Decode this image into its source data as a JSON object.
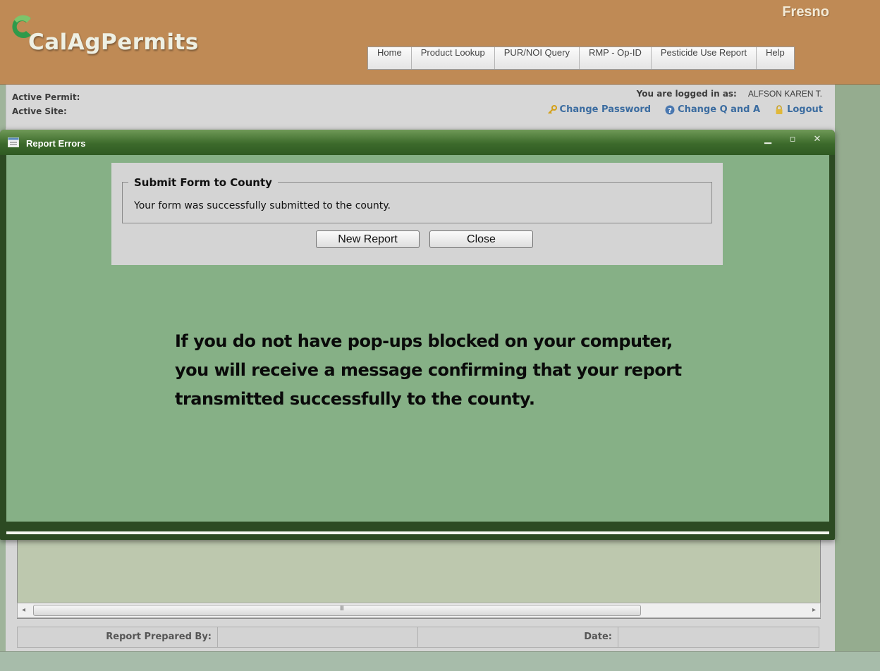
{
  "header": {
    "logo_text": "CalAgPermits",
    "county": "Fresno",
    "nav": [
      {
        "label": "Home"
      },
      {
        "label": "Product Lookup"
      },
      {
        "label": "PUR/NOI Query"
      },
      {
        "label": "RMP - Op-ID"
      },
      {
        "label": "Pesticide Use Report"
      },
      {
        "label": "Help"
      }
    ]
  },
  "info_bar": {
    "active_permit_label": "Active Permit:",
    "active_site_label": "Active Site:",
    "logged_in_label": "You are logged in as:",
    "user_name": "ALFSON KAREN T.",
    "change_password": "Change Password",
    "change_qa": "Change Q and A",
    "logout": "Logout"
  },
  "modal": {
    "title": "Report Errors",
    "fieldset_legend": "Submit Form to County",
    "message": "Your form was successfully submitted to the county.",
    "new_report_button": "New Report",
    "close_button": "Close"
  },
  "annotation": {
    "lines": [
      "If you do not have pop-ups blocked on your computer,",
      "you will receive a message confirming that your report",
      "transmitted successfully to the county."
    ]
  },
  "footer": {
    "prepared_by_label": "Report Prepared By:",
    "date_label": "Date:"
  },
  "scrollbar": {
    "grip": "III"
  },
  "colors": {
    "header_bg": "#bf8a55",
    "modal_titlebar": "#3c6a2b",
    "modal_body": "#86b086",
    "link": "#3b6ca0"
  }
}
